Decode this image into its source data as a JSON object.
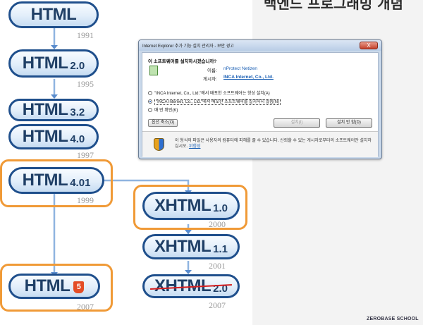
{
  "slide": {
    "title": "백엔드 프로그래밍 개념",
    "brand": "ZEROBASE SCHOOL"
  },
  "timeline": [
    {
      "id": "html",
      "label": "HTML",
      "version": "",
      "year": "1991"
    },
    {
      "id": "html20",
      "label": "HTML",
      "version": "2.0",
      "year": "1995"
    },
    {
      "id": "html32",
      "label": "HTML",
      "version": "3.2",
      "year": ""
    },
    {
      "id": "html40",
      "label": "HTML",
      "version": "4.0",
      "year": "1997"
    },
    {
      "id": "html401",
      "label": "HTML",
      "version": "4.01",
      "year": "1999"
    },
    {
      "id": "xhtml10",
      "label": "XHTML",
      "version": "1.0",
      "year": "2000"
    },
    {
      "id": "xhtml11",
      "label": "XHTML",
      "version": "1.1",
      "year": "2001"
    },
    {
      "id": "xhtml20",
      "label": "XHTML",
      "version": "2.0",
      "year": "2007"
    },
    {
      "id": "html5",
      "label": "HTML",
      "version": "5",
      "year": "2007"
    }
  ],
  "colors": {
    "pill_border": "#1f4f8c",
    "highlight": "#f09a37",
    "connector": "#8fb4e0",
    "strike": "#d62020"
  },
  "dialog": {
    "title": "Internet Explorer 추가 기능 설치 관리자 - 보안 경고",
    "close_symbol": "X",
    "question": "이 소프트웨어를 설치하시겠습니까?",
    "name_label": "이름:",
    "name_value": "nProtect Netizen",
    "publisher_label": "게시자:",
    "publisher_value": "INCA Internet, Co., Ltd.",
    "options": [
      {
        "text": "\"INCA Internet, Co., Ltd.\"에서 배포한 소프트웨어는 항상 설치(A)",
        "selected": false
      },
      {
        "text": "\"INCA Internet, Co., Ltd.\"에서 배포한 소프트웨어를 설치하지 않음(N)",
        "selected": true
      },
      {
        "text": "매 번 확인(K)",
        "selected": false
      }
    ],
    "options_button": "옵션 축소(O)",
    "install_button": "설치(I)",
    "dont_install_button": "설치 안 함(D)",
    "warning_text": "이 형식의 파일은 사용자의 컴퓨터에 피해를 줄 수 있습니다. 신뢰할 수 있는 게시자로부터의 소프트웨어만 설치하십시오.",
    "warning_link": "위험성",
    "warning_icon": "shield-icon"
  }
}
